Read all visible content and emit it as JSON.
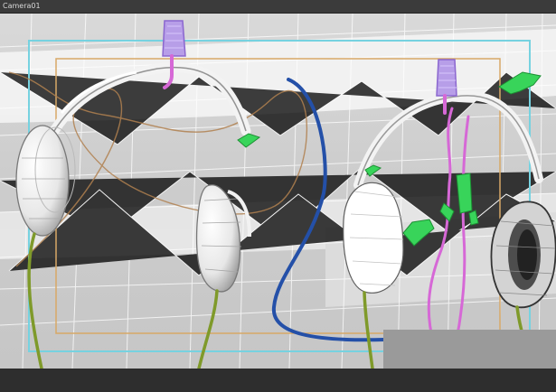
{
  "viewport": {
    "title": "Camera01",
    "render_mode": "wireframe-over-shaded",
    "objects": [
      {
        "name": "headphones-left",
        "color": "#ffffff"
      },
      {
        "name": "headphones-right",
        "color": "#ffffff"
      },
      {
        "name": "microphone-left",
        "color": "#b79ee8"
      },
      {
        "name": "microphone-right",
        "color": "#b79ee8"
      },
      {
        "name": "blue-cable",
        "color": "#2450a8"
      },
      {
        "name": "pink-cable",
        "color": "#d668d6"
      },
      {
        "name": "olive-cable",
        "color": "#7f9a2a"
      },
      {
        "name": "brown-spline",
        "color": "#b0804f"
      },
      {
        "name": "green-helpers",
        "color": "#38d45a"
      }
    ],
    "frame_colors": {
      "safe_frame_outer": "#76d2e0",
      "safe_frame_inner": "#d7a867"
    }
  }
}
